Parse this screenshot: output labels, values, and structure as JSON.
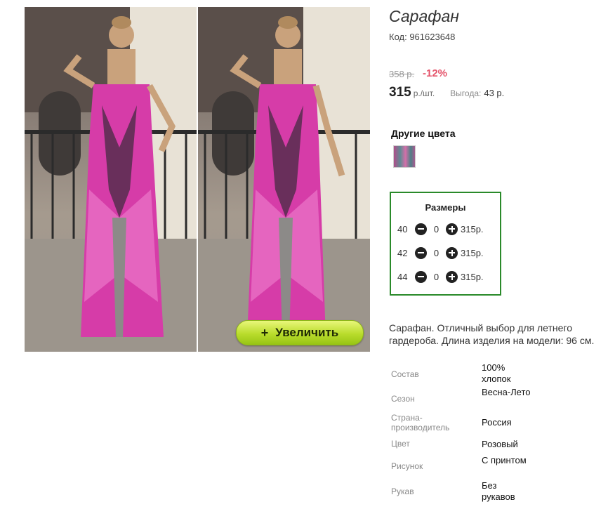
{
  "gallery": {
    "zoom_label": "Увеличить",
    "zoom_icon": "plus-icon"
  },
  "product": {
    "title": "Сарафан",
    "code": "Код: 961623648",
    "old_price": "358 р.",
    "discount": "-12%",
    "price": "315",
    "price_unit": "р./шт.",
    "benefit_label": "Выгода:",
    "benefit_value": "43 р."
  },
  "colors": {
    "title": "Другие цвета"
  },
  "sizes": {
    "title": "Размеры",
    "rows": [
      {
        "size": "40",
        "qty": "0",
        "price": "315р."
      },
      {
        "size": "42",
        "qty": "0",
        "price": "315р."
      },
      {
        "size": "44",
        "qty": "0",
        "price": "315р."
      }
    ]
  },
  "description": "Сарафан. Отличный выбор для летнего гардероба. Длина изделия на модели: 96 см.",
  "attributes": [
    {
      "label": "Состав",
      "value": "100% хлопок"
    },
    {
      "label": "Сезон",
      "value": "Весна-Лето"
    },
    {
      "label": "Страна-производитель",
      "value": "Россия"
    },
    {
      "label": "Цвет",
      "value": "Розовый"
    },
    {
      "label": "Рисунок",
      "value": "С принтом"
    },
    {
      "label": "Рукав",
      "value": "Без рукавов"
    }
  ],
  "colors_palette": {
    "accent_green": "#2a8a2a",
    "discount_red": "#e4536a",
    "button_lime": "#b9dc2c",
    "dress_pink": "#d63ca8"
  }
}
